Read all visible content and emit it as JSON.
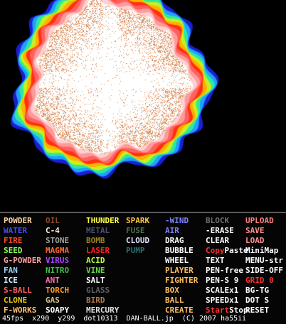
{
  "panel": {
    "columns": [
      [
        {
          "label": "POWDER",
          "color": "#ffd6a6"
        },
        {
          "label": "WATER",
          "color": "#4a4aff"
        },
        {
          "label": "FIRE",
          "color": "#ff4a2a"
        },
        {
          "label": "SEED",
          "color": "#8aff5a"
        },
        {
          "label": "G-POWDER",
          "color": "#ffa0a0"
        },
        {
          "label": "FAN",
          "color": "#9ad0ff"
        },
        {
          "label": "ICE",
          "color": "#d8f0ff"
        },
        {
          "label": "S-BALL",
          "color": "#ff6060"
        },
        {
          "label": "CLONE",
          "color": "#e6c800"
        },
        {
          "label": "F-WORKS",
          "color": "#ffc070"
        }
      ],
      [
        {
          "label": "OIL",
          "color": "#8a4a2a"
        },
        {
          "label": "C-4",
          "color": "#fff0d0"
        },
        {
          "label": "STONE",
          "color": "#a0a0a0"
        },
        {
          "label": "MAGMA",
          "color": "#ff6a3a"
        },
        {
          "label": "VIRUS",
          "color": "#b040ff"
        },
        {
          "label": "NITRO",
          "color": "#40c040"
        },
        {
          "label": "ANT",
          "color": "#ff70b0"
        },
        {
          "label": "TORCH",
          "color": "#ff9a2a"
        },
        {
          "label": "GAS",
          "color": "#d0c090"
        },
        {
          "label": "SOAPY",
          "color": "#ffffff"
        }
      ],
      [
        {
          "label": "THUNDER",
          "color": "#ffff40"
        },
        {
          "label": "METAL",
          "color": "#505070"
        },
        {
          "label": "BOMB",
          "color": "#a08020"
        },
        {
          "label": "LASER",
          "color": "#ff2020"
        },
        {
          "label": "ACID",
          "color": "#c0ff40"
        },
        {
          "label": "VINE",
          "color": "#60e040"
        },
        {
          "label": "SALT",
          "color": "#ffffff"
        },
        {
          "label": "GLASS",
          "color": "#606060"
        },
        {
          "label": "BIRD",
          "color": "#b07a4a"
        },
        {
          "label": "MERCURY",
          "color": "#e0e0e0"
        }
      ],
      [
        {
          "label": "SPARK",
          "color": "#ffc840"
        },
        {
          "label": "FUSE",
          "color": "#507050"
        },
        {
          "label": "CLOUD",
          "color": "#e0e0ff"
        },
        {
          "label": "PUMP",
          "color": "#2a7070"
        }
      ],
      [
        {
          "label": "-WIND",
          "color": "#8080ff"
        },
        {
          "label": "AIR",
          "color": "#8080ff"
        },
        {
          "label": "DRAG",
          "color": "#ffffff"
        },
        {
          "label": "BUBBLE",
          "color": "#ffffff"
        },
        {
          "label": "WHEEL",
          "color": "#ffffff"
        },
        {
          "label": "PLAYER",
          "color": "#ffc060"
        },
        {
          "label": "FIGHTER",
          "color": "#ffc060"
        },
        {
          "label": "BOX",
          "color": "#ffc060"
        },
        {
          "label": "BALL",
          "color": "#ffc060"
        },
        {
          "label": "CREATE",
          "color": "#ffc060"
        }
      ],
      [
        {
          "label": "BLOCK",
          "color": "#707070"
        },
        {
          "label": "-ERASE",
          "color": "#ffffff"
        },
        {
          "label": "CLEAR",
          "color": "#ffffff"
        },
        {
          "parts": [
            {
              "t": "Copy",
              "color": "#ff3030"
            },
            {
              "t": "Paste",
              "color": "#ffffff"
            }
          ]
        },
        {
          "label": "TEXT",
          "color": "#ffffff"
        },
        {
          "label": "PEN-free",
          "color": "#ffffff"
        },
        {
          "label": "PEN-S 9",
          "color": "#ffffff"
        },
        {
          "label": "SCALEx1",
          "color": "#ffffff"
        },
        {
          "label": "SPEEDx1",
          "color": "#ffffff"
        },
        {
          "parts": [
            {
              "t": "Start",
              "color": "#ff3030"
            },
            {
              "t": "Stop",
              "color": "#ffffff"
            }
          ]
        }
      ],
      [
        {
          "label": "UPLOAD",
          "color": "#ff8080"
        },
        {
          "label": "SAVE",
          "color": "#ff9090"
        },
        {
          "label": "LOAD",
          "color": "#ff9090"
        },
        {
          "label": "MiniMap",
          "color": "#ffffff"
        },
        {
          "label": "MENU-str",
          "color": "#ffffff"
        },
        {
          "label": "SIDE-OFF",
          "color": "#ffffff"
        },
        {
          "label": "GRID 0",
          "color": "#ff3030"
        },
        {
          "label": "BG-TG",
          "color": "#ffffff"
        },
        {
          "label": "DOT S",
          "color": "#ffffff"
        },
        {
          "label": "RESET",
          "color": "#ffffff"
        }
      ]
    ]
  },
  "status": {
    "fps": "45fps",
    "x": "x290",
    "y": "y299",
    "dots": "dot10313",
    "site": "DAN-BALL.jp",
    "copyright": "(C) 2007 ha55ii"
  },
  "colors": {
    "background": "#000000",
    "panel_border": "#5a5a5a",
    "particle": "#d9864f"
  }
}
